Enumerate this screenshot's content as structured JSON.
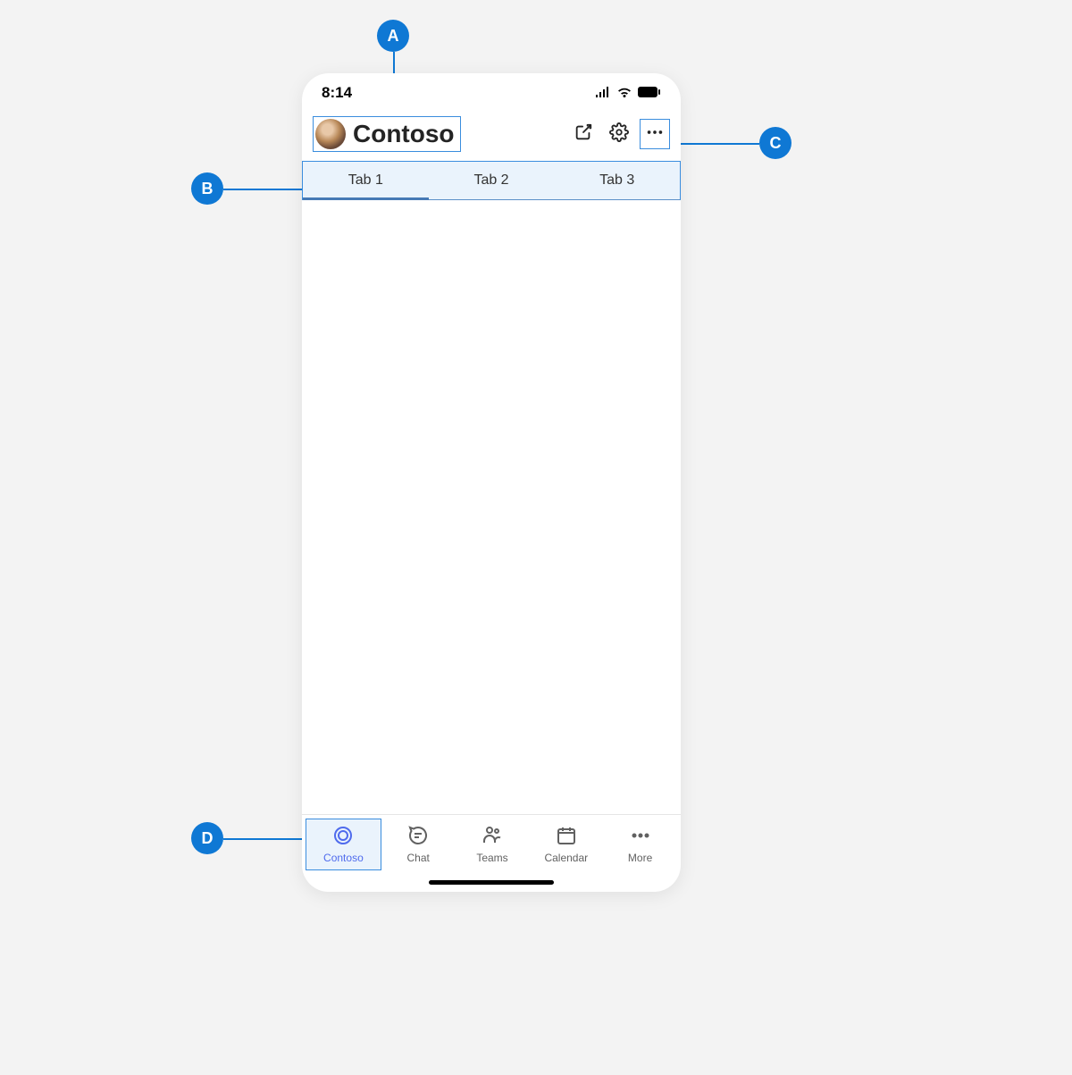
{
  "status": {
    "time": "8:14"
  },
  "header": {
    "title": "Contoso"
  },
  "tabs": [
    {
      "label": "Tab 1",
      "active": true
    },
    {
      "label": "Tab 2",
      "active": false
    },
    {
      "label": "Tab 3",
      "active": false
    }
  ],
  "nav": [
    {
      "label": "Contoso",
      "icon": "contoso",
      "active": true
    },
    {
      "label": "Chat",
      "icon": "chat",
      "active": false
    },
    {
      "label": "Teams",
      "icon": "teams",
      "active": false
    },
    {
      "label": "Calendar",
      "icon": "calendar",
      "active": false
    },
    {
      "label": "More",
      "icon": "more",
      "active": false
    }
  ],
  "callouts": {
    "A": "A",
    "B": "B",
    "C": "C",
    "D": "D"
  }
}
